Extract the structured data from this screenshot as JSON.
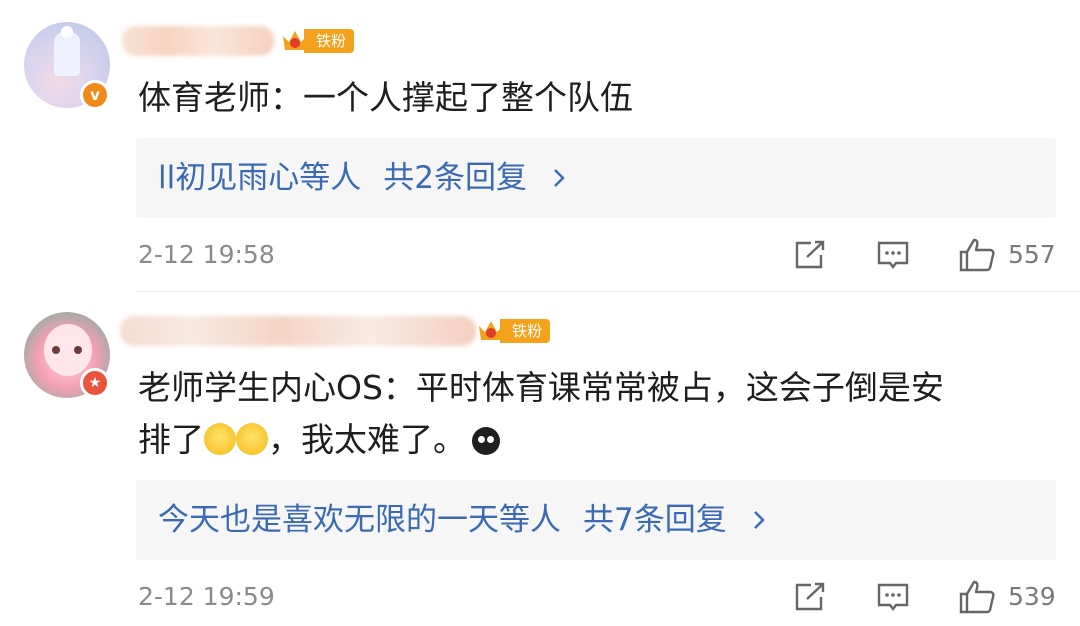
{
  "comments": [
    {
      "fan_label": "铁粉",
      "text": "体育老师：一个人撑起了整个队伍",
      "replies": {
        "who": "ll初见雨心等人",
        "count": "共2条回复"
      },
      "time": "2-12 19:58",
      "likes": "557"
    },
    {
      "fan_label": "铁粉",
      "text_line1": "老师学生内心OS：平时体育课常常被占，这会子倒是安",
      "text_line2_a": "排了",
      "text_line2_b": "，我太难了。",
      "replies": {
        "who": "今天也是喜欢无限的一天等人",
        "count": "共7条回复"
      },
      "time": "2-12 19:59",
      "likes": "539"
    }
  ],
  "colors": {
    "link": "#3a6ab4",
    "fan_badge": "#f4a21b",
    "reply_bg": "#f6f6f6"
  },
  "icons": [
    "crown-icon",
    "chevron-right-icon",
    "share-icon",
    "comment-icon",
    "like-icon",
    "sweat-smile-emoji",
    "crying-emoji"
  ]
}
